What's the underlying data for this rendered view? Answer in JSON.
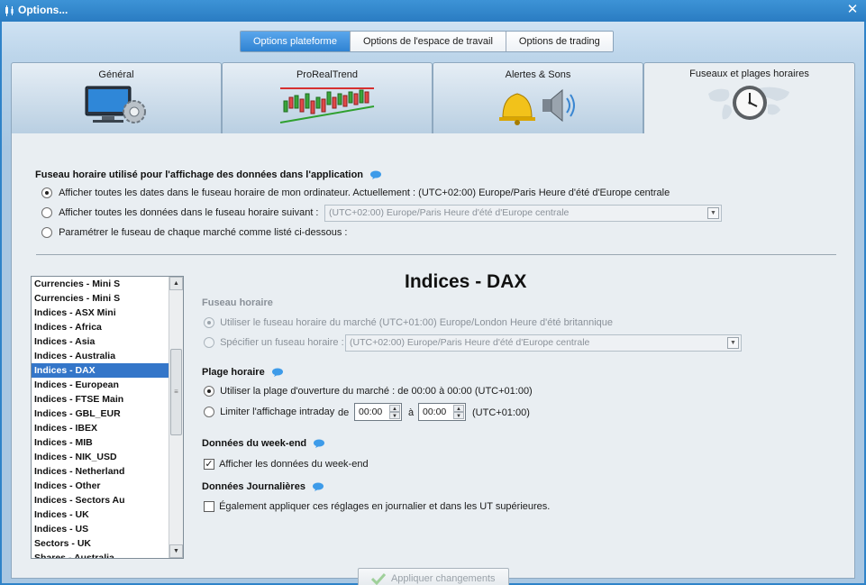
{
  "window": {
    "title": "Options...",
    "close_glyph": "✕"
  },
  "top_segments": [
    {
      "label": "Options plateforme",
      "active": true
    },
    {
      "label": "Options de l'espace de travail",
      "active": false
    },
    {
      "label": "Options de trading",
      "active": false
    }
  ],
  "tabs": [
    {
      "label": "Général",
      "icon": "monitor-gear-icon"
    },
    {
      "label": "ProRealTrend",
      "icon": "trend-chart-icon"
    },
    {
      "label": "Alertes & Sons",
      "icon": "bell-speaker-icon"
    },
    {
      "label": "Fuseaux et plages horaires",
      "icon": "world-clock-icon",
      "active": true
    }
  ],
  "timezone_section": {
    "title": "Fuseau horaire utilisé pour l'affichage des données dans l'application",
    "options": [
      {
        "label": "Afficher toutes les dates dans le fuseau horaire de mon ordinateur. Actuellement : (UTC+02:00) Europe/Paris Heure d'été d'Europe centrale",
        "checked": true
      },
      {
        "label": "Afficher toutes les données dans le fuseau horaire suivant :",
        "checked": false
      },
      {
        "label": "Paramétrer le fuseau de chaque marché comme listé ci-dessous :",
        "checked": false
      }
    ],
    "combo_value": "(UTC+02:00) Europe/Paris Heure d'été d'Europe centrale"
  },
  "market_list": {
    "items": [
      "Currencies - Mini S",
      "Currencies - Mini S",
      "Indices - ASX Mini",
      "Indices - Africa",
      "Indices - Asia",
      "Indices - Australia",
      "Indices - DAX",
      "Indices - European",
      "Indices - FTSE Main",
      "Indices - GBL_EUR",
      "Indices - IBEX",
      "Indices - MIB",
      "Indices - NIK_USD",
      "Indices - Netherland",
      "Indices - Other",
      "Indices - Sectors Au",
      "Indices - UK",
      "Indices - US",
      "Sectors - UK",
      "Shares - Australia"
    ],
    "selected": "Indices - DAX"
  },
  "detail": {
    "title": "Indices - DAX",
    "fuseau": {
      "title": "Fuseau horaire",
      "market_option": "Utiliser le fuseau horaire du marché (UTC+01:00) Europe/London Heure d'été britannique",
      "specify_option": "Spécifier un fuseau horaire :",
      "specify_value": "(UTC+02:00) Europe/Paris Heure d'été d'Europe centrale"
    },
    "plage": {
      "title": "Plage horaire",
      "opening_option": "Utiliser la plage d'ouverture du marché : de 00:00 à 00:00  (UTC+01:00)",
      "limit_option": "Limiter l'affichage intraday",
      "de": "de",
      "a": "à",
      "from": "00:00",
      "to": "00:00",
      "tz": "(UTC+01:00)"
    },
    "weekend": {
      "title": "Données du week-end",
      "option": "Afficher les données du week-end",
      "checked": true
    },
    "journalieres": {
      "title": "Données Journalières",
      "option": "Également appliquer ces réglages en journalier et dans les UT supérieures.",
      "checked": false
    },
    "apply_button": "Appliquer changements"
  },
  "colors": {
    "title_bar": "#2a7cc2",
    "active_segment": "#3a8ddb",
    "selection": "#3476c9",
    "panel": "#e9eef2"
  }
}
